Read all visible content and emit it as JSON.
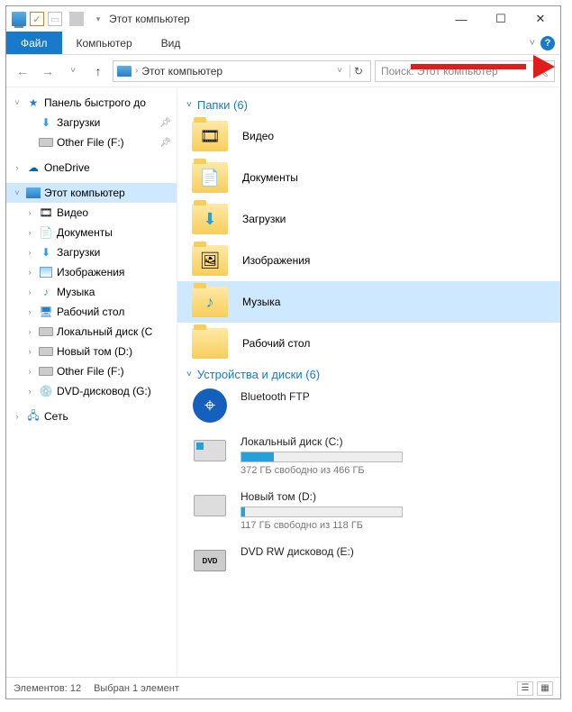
{
  "titlebar": {
    "title": "Этот компьютер"
  },
  "ribbon": {
    "file": "Файл",
    "computer": "Компьютер",
    "view": "Вид",
    "expand": "˅"
  },
  "address": {
    "crumb": "Этот компьютер",
    "search_placeholder": "Поиск: Этот компьютер"
  },
  "nav": {
    "quick": "Панель быстрого до",
    "downloads": "Загрузки",
    "other_file": "Other File (F:)",
    "onedrive": "OneDrive",
    "this_pc": "Этот компьютер",
    "video": "Видео",
    "documents": "Документы",
    "downloads2": "Загрузки",
    "images": "Изображения",
    "music": "Музыка",
    "desktop": "Рабочий стол",
    "local_c": "Локальный диск (C",
    "new_d": "Новый том (D:)",
    "other_f": "Other File (F:)",
    "dvd_g": "DVD-дисковод (G:)",
    "network": "Сеть"
  },
  "sections": {
    "folders": "Папки (6)",
    "devices": "Устройства и диски (6)"
  },
  "folders": {
    "video": "Видео",
    "documents": "Документы",
    "downloads": "Загрузки",
    "images": "Изображения",
    "music": "Музыка",
    "desktop": "Рабочий стол"
  },
  "drives": {
    "bt": "Bluetooth FTP",
    "c_name": "Локальный диск (C:)",
    "c_sub": "372 ГБ свободно из 466 ГБ",
    "c_fill": 20,
    "d_name": "Новый том (D:)",
    "d_sub": "117 ГБ свободно из 118 ГБ",
    "d_fill": 2,
    "e_name": "DVD RW дисковод (E:)"
  },
  "status": {
    "count": "Элементов: 12",
    "selected": "Выбран 1 элемент"
  }
}
